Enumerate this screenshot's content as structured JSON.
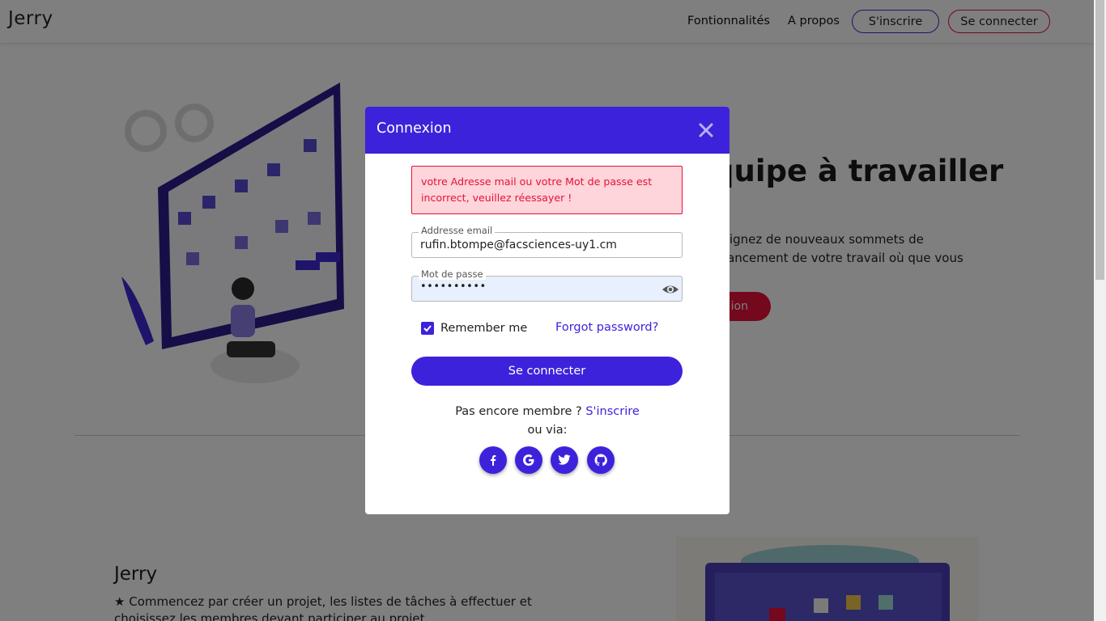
{
  "header": {
    "brand": "Jerry",
    "nav": [
      "Fontionnalités",
      "A propos"
    ],
    "signup_button": "S'inscrire",
    "login_button": "Se connecter"
  },
  "hero": {
    "title_fragment": "quipe à travailler",
    "text_line1": "tteignez de nouveaux sommets de",
    "text_line2": "avancement de votre travail où que vous",
    "cta_fragment": "ion"
  },
  "section": {
    "title": "Jerry",
    "text": "Commencez par créer un projet, les listes de tâches à effectuer et choisissez les membres devant participer au projet"
  },
  "modal": {
    "title": "Connexion",
    "error": "votre Adresse mail ou votre Mot de passe est incorrect, veuillez réessayer !",
    "email_label": "Addresse email",
    "email_value": "rufin.btompe@facsciences-uy1.cm",
    "password_label": "Mot de passe",
    "password_value": "••••••••••",
    "remember_label": "Remember me",
    "remember_checked": true,
    "forgot_label": "Forgot password?",
    "submit_label": "Se connecter",
    "signup_prompt": "Pas encore membre ?",
    "signup_link": "S'inscrire",
    "via_label": "ou via:",
    "social_icons": [
      "facebook-icon",
      "google-icon",
      "twitter-icon",
      "github-icon"
    ]
  },
  "colors": {
    "primary": "#3d22dc",
    "danger": "#e8103a",
    "alert_bg": "#fdd5da",
    "autofill_bg": "#e8f0fe"
  }
}
